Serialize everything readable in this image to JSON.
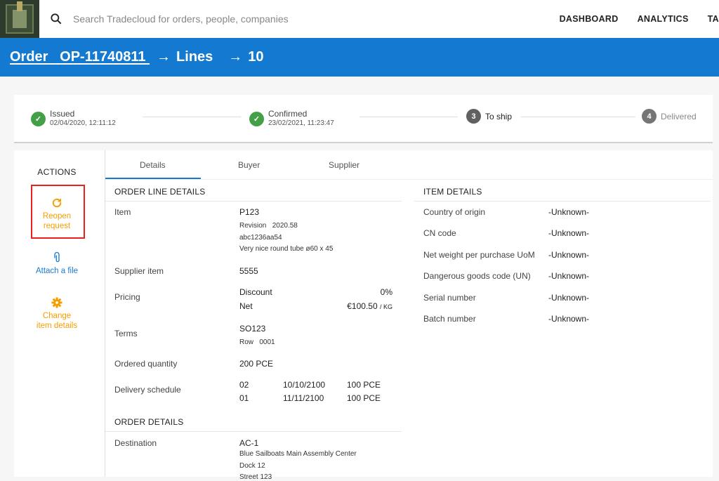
{
  "topbar": {
    "search_placeholder": "Search Tradecloud for orders, people, companies",
    "nav": [
      "DASHBOARD",
      "ANALYTICS",
      "TA"
    ]
  },
  "breadcrumb": {
    "order_label": "Order",
    "order_id": "OP-11740811",
    "lines": "Lines",
    "line_no": "10",
    "arrow": "→"
  },
  "stepper": {
    "steps": [
      {
        "name": "Issued",
        "date": "02/04/2020, 12:11:12",
        "state": "done"
      },
      {
        "name": "Confirmed",
        "date": "23/02/2021, 11:23:47",
        "state": "done"
      },
      {
        "name": "To ship",
        "number": "3",
        "state": "active"
      },
      {
        "name": "Delivered",
        "number": "4",
        "state": "pending"
      }
    ]
  },
  "actions": {
    "title": "ACTIONS",
    "items": [
      {
        "label1": "Reopen",
        "label2": "request",
        "icon": "refresh-icon"
      },
      {
        "label1": "Attach a file",
        "icon": "paperclip-icon"
      },
      {
        "label1": "Change",
        "label2": "item details",
        "icon": "gear-icon"
      }
    ]
  },
  "tabs": [
    "Details",
    "Buyer",
    "Supplier"
  ],
  "order_line_details": {
    "title": "ORDER LINE DETAILS",
    "item_label": "Item",
    "item_value": "P123",
    "revision_label": "Revision",
    "revision_value": "2020.58",
    "item_code": "abc1236aa54",
    "item_desc": "Very nice round tube ø60 x 45",
    "supplier_item_label": "Supplier item",
    "supplier_item_value": "5555",
    "pricing_label": "Pricing",
    "discount_label": "Discount",
    "discount_value": "0%",
    "net_label": "Net",
    "net_value": "€100.50",
    "net_unit": "/ KG",
    "terms_label": "Terms",
    "terms_value": "SO123",
    "row_label": "Row",
    "row_value": "0001",
    "ordered_qty_label": "Ordered quantity",
    "ordered_qty_value": "200 PCE",
    "delivery_label": "Delivery schedule",
    "delivery": [
      {
        "line": "02",
        "date": "10/10/2100",
        "qty": "100 PCE"
      },
      {
        "line": "01",
        "date": "11/11/2100",
        "qty": "100 PCE"
      }
    ]
  },
  "order_details": {
    "title": "ORDER DETAILS",
    "destination_label": "Destination",
    "destination_code": "AC-1",
    "destination_line1": "Blue Sailboats Main Assembly Center",
    "destination_line2": "Dock 12",
    "destination_line3": "Street 123"
  },
  "item_details": {
    "title": "ITEM DETAILS",
    "rows": [
      {
        "label": "Country of origin",
        "value": "-Unknown-"
      },
      {
        "label": "CN code",
        "value": "-Unknown-"
      },
      {
        "label": "Net weight per purchase UoM",
        "value": "-Unknown-"
      },
      {
        "label": "Dangerous goods code (UN)",
        "value": "-Unknown-"
      },
      {
        "label": "Serial number",
        "value": "-Unknown-"
      },
      {
        "label": "Batch number",
        "value": "-Unknown-"
      }
    ]
  },
  "colors": {
    "primary": "#1479d1",
    "success": "#43a047",
    "accent": "#f59e00",
    "highlight": "#e52222"
  }
}
